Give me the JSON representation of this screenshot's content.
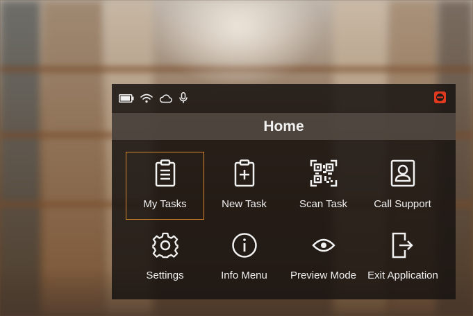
{
  "status_bar": {
    "icons": [
      "battery-icon",
      "wifi-icon",
      "cloud-icon",
      "microphone-icon"
    ],
    "app_badge_icon": "app-logo-icon",
    "battery_level": 0.85
  },
  "header": {
    "title": "Home"
  },
  "menu": {
    "items": [
      {
        "label": "My Tasks",
        "icon": "clipboard-list-icon",
        "selected": true
      },
      {
        "label": "New Task",
        "icon": "clipboard-plus-icon",
        "selected": false
      },
      {
        "label": "Scan Task",
        "icon": "qr-code-icon",
        "selected": false
      },
      {
        "label": "Call Support",
        "icon": "contact-card-icon",
        "selected": false
      },
      {
        "label": "Settings",
        "icon": "gear-icon",
        "selected": false
      },
      {
        "label": "Info Menu",
        "icon": "info-icon",
        "selected": false
      },
      {
        "label": "Preview Mode",
        "icon": "eye-icon",
        "selected": false
      },
      {
        "label": "Exit Application",
        "icon": "exit-icon",
        "selected": false
      }
    ]
  },
  "colors": {
    "accent": "#d9892c",
    "badge": "#e0391f",
    "panel": "#18140f",
    "header": "#585048",
    "text": "#f0f0f0"
  }
}
